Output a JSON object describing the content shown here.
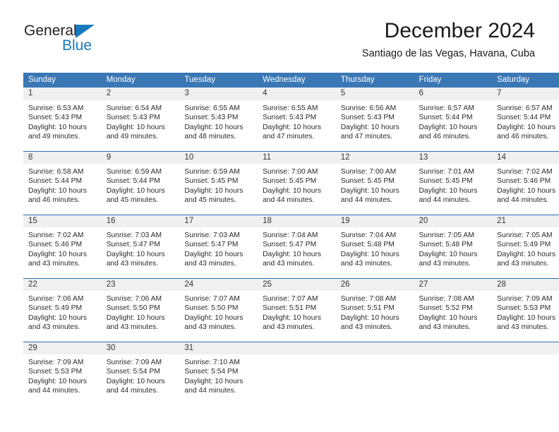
{
  "brand": {
    "name_part1": "General",
    "name_part2": "Blue",
    "triangle_icon": "blue-triangle-logo-mark",
    "color_dark": "#231f20",
    "color_blue": "#1878be"
  },
  "header": {
    "month_title": "December 2024",
    "location": "Santiago de las Vegas, Havana, Cuba"
  },
  "calendar": {
    "header_bg": "#3a77b5",
    "daynum_bg": "#f0f0f0",
    "separator_color": "#2a6db0",
    "weekday_headers": [
      "Sunday",
      "Monday",
      "Tuesday",
      "Wednesday",
      "Thursday",
      "Friday",
      "Saturday"
    ],
    "weeks": [
      [
        {
          "date": "1",
          "sunrise": "Sunrise: 6:53 AM",
          "sunset": "Sunset: 5:43 PM",
          "daylight_line1": "Daylight: 10 hours",
          "daylight_line2": "and 49 minutes."
        },
        {
          "date": "2",
          "sunrise": "Sunrise: 6:54 AM",
          "sunset": "Sunset: 5:43 PM",
          "daylight_line1": "Daylight: 10 hours",
          "daylight_line2": "and 49 minutes."
        },
        {
          "date": "3",
          "sunrise": "Sunrise: 6:55 AM",
          "sunset": "Sunset: 5:43 PM",
          "daylight_line1": "Daylight: 10 hours",
          "daylight_line2": "and 48 minutes."
        },
        {
          "date": "4",
          "sunrise": "Sunrise: 6:55 AM",
          "sunset": "Sunset: 5:43 PM",
          "daylight_line1": "Daylight: 10 hours",
          "daylight_line2": "and 47 minutes."
        },
        {
          "date": "5",
          "sunrise": "Sunrise: 6:56 AM",
          "sunset": "Sunset: 5:43 PM",
          "daylight_line1": "Daylight: 10 hours",
          "daylight_line2": "and 47 minutes."
        },
        {
          "date": "6",
          "sunrise": "Sunrise: 6:57 AM",
          "sunset": "Sunset: 5:44 PM",
          "daylight_line1": "Daylight: 10 hours",
          "daylight_line2": "and 46 minutes."
        },
        {
          "date": "7",
          "sunrise": "Sunrise: 6:57 AM",
          "sunset": "Sunset: 5:44 PM",
          "daylight_line1": "Daylight: 10 hours",
          "daylight_line2": "and 46 minutes."
        }
      ],
      [
        {
          "date": "8",
          "sunrise": "Sunrise: 6:58 AM",
          "sunset": "Sunset: 5:44 PM",
          "daylight_line1": "Daylight: 10 hours",
          "daylight_line2": "and 46 minutes."
        },
        {
          "date": "9",
          "sunrise": "Sunrise: 6:59 AM",
          "sunset": "Sunset: 5:44 PM",
          "daylight_line1": "Daylight: 10 hours",
          "daylight_line2": "and 45 minutes."
        },
        {
          "date": "10",
          "sunrise": "Sunrise: 6:59 AM",
          "sunset": "Sunset: 5:45 PM",
          "daylight_line1": "Daylight: 10 hours",
          "daylight_line2": "and 45 minutes."
        },
        {
          "date": "11",
          "sunrise": "Sunrise: 7:00 AM",
          "sunset": "Sunset: 5:45 PM",
          "daylight_line1": "Daylight: 10 hours",
          "daylight_line2": "and 44 minutes."
        },
        {
          "date": "12",
          "sunrise": "Sunrise: 7:00 AM",
          "sunset": "Sunset: 5:45 PM",
          "daylight_line1": "Daylight: 10 hours",
          "daylight_line2": "and 44 minutes."
        },
        {
          "date": "13",
          "sunrise": "Sunrise: 7:01 AM",
          "sunset": "Sunset: 5:45 PM",
          "daylight_line1": "Daylight: 10 hours",
          "daylight_line2": "and 44 minutes."
        },
        {
          "date": "14",
          "sunrise": "Sunrise: 7:02 AM",
          "sunset": "Sunset: 5:46 PM",
          "daylight_line1": "Daylight: 10 hours",
          "daylight_line2": "and 44 minutes."
        }
      ],
      [
        {
          "date": "15",
          "sunrise": "Sunrise: 7:02 AM",
          "sunset": "Sunset: 5:46 PM",
          "daylight_line1": "Daylight: 10 hours",
          "daylight_line2": "and 43 minutes."
        },
        {
          "date": "16",
          "sunrise": "Sunrise: 7:03 AM",
          "sunset": "Sunset: 5:47 PM",
          "daylight_line1": "Daylight: 10 hours",
          "daylight_line2": "and 43 minutes."
        },
        {
          "date": "17",
          "sunrise": "Sunrise: 7:03 AM",
          "sunset": "Sunset: 5:47 PM",
          "daylight_line1": "Daylight: 10 hours",
          "daylight_line2": "and 43 minutes."
        },
        {
          "date": "18",
          "sunrise": "Sunrise: 7:04 AM",
          "sunset": "Sunset: 5:47 PM",
          "daylight_line1": "Daylight: 10 hours",
          "daylight_line2": "and 43 minutes."
        },
        {
          "date": "19",
          "sunrise": "Sunrise: 7:04 AM",
          "sunset": "Sunset: 5:48 PM",
          "daylight_line1": "Daylight: 10 hours",
          "daylight_line2": "and 43 minutes."
        },
        {
          "date": "20",
          "sunrise": "Sunrise: 7:05 AM",
          "sunset": "Sunset: 5:48 PM",
          "daylight_line1": "Daylight: 10 hours",
          "daylight_line2": "and 43 minutes."
        },
        {
          "date": "21",
          "sunrise": "Sunrise: 7:05 AM",
          "sunset": "Sunset: 5:49 PM",
          "daylight_line1": "Daylight: 10 hours",
          "daylight_line2": "and 43 minutes."
        }
      ],
      [
        {
          "date": "22",
          "sunrise": "Sunrise: 7:06 AM",
          "sunset": "Sunset: 5:49 PM",
          "daylight_line1": "Daylight: 10 hours",
          "daylight_line2": "and 43 minutes."
        },
        {
          "date": "23",
          "sunrise": "Sunrise: 7:06 AM",
          "sunset": "Sunset: 5:50 PM",
          "daylight_line1": "Daylight: 10 hours",
          "daylight_line2": "and 43 minutes."
        },
        {
          "date": "24",
          "sunrise": "Sunrise: 7:07 AM",
          "sunset": "Sunset: 5:50 PM",
          "daylight_line1": "Daylight: 10 hours",
          "daylight_line2": "and 43 minutes."
        },
        {
          "date": "25",
          "sunrise": "Sunrise: 7:07 AM",
          "sunset": "Sunset: 5:51 PM",
          "daylight_line1": "Daylight: 10 hours",
          "daylight_line2": "and 43 minutes."
        },
        {
          "date": "26",
          "sunrise": "Sunrise: 7:08 AM",
          "sunset": "Sunset: 5:51 PM",
          "daylight_line1": "Daylight: 10 hours",
          "daylight_line2": "and 43 minutes."
        },
        {
          "date": "27",
          "sunrise": "Sunrise: 7:08 AM",
          "sunset": "Sunset: 5:52 PM",
          "daylight_line1": "Daylight: 10 hours",
          "daylight_line2": "and 43 minutes."
        },
        {
          "date": "28",
          "sunrise": "Sunrise: 7:09 AM",
          "sunset": "Sunset: 5:53 PM",
          "daylight_line1": "Daylight: 10 hours",
          "daylight_line2": "and 43 minutes."
        }
      ],
      [
        {
          "date": "29",
          "sunrise": "Sunrise: 7:09 AM",
          "sunset": "Sunset: 5:53 PM",
          "daylight_line1": "Daylight: 10 hours",
          "daylight_line2": "and 44 minutes."
        },
        {
          "date": "30",
          "sunrise": "Sunrise: 7:09 AM",
          "sunset": "Sunset: 5:54 PM",
          "daylight_line1": "Daylight: 10 hours",
          "daylight_line2": "and 44 minutes."
        },
        {
          "date": "31",
          "sunrise": "Sunrise: 7:10 AM",
          "sunset": "Sunset: 5:54 PM",
          "daylight_line1": "Daylight: 10 hours",
          "daylight_line2": "and 44 minutes."
        },
        {
          "date": "",
          "sunrise": "",
          "sunset": "",
          "daylight_line1": "",
          "daylight_line2": ""
        },
        {
          "date": "",
          "sunrise": "",
          "sunset": "",
          "daylight_line1": "",
          "daylight_line2": ""
        },
        {
          "date": "",
          "sunrise": "",
          "sunset": "",
          "daylight_line1": "",
          "daylight_line2": ""
        },
        {
          "date": "",
          "sunrise": "",
          "sunset": "",
          "daylight_line1": "",
          "daylight_line2": ""
        }
      ]
    ]
  }
}
